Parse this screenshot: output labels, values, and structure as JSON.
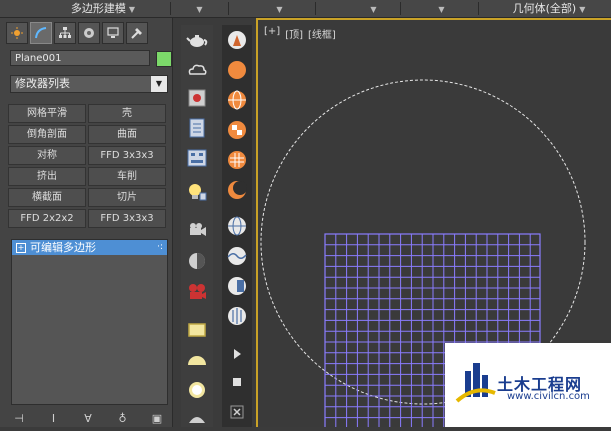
{
  "topbar": {
    "segments": [
      {
        "label": "多边形建模",
        "caret": "▼"
      },
      {
        "label": "",
        "caret": "▼"
      },
      {
        "label": "",
        "caret": "▼"
      },
      {
        "label": "",
        "caret": "▼"
      },
      {
        "label": "",
        "caret": "▼"
      },
      {
        "label": "几何体(全部)",
        "caret": "▼"
      }
    ]
  },
  "panel": {
    "tabs": [
      {
        "icon": "create-icon"
      },
      {
        "icon": "modify-icon"
      },
      {
        "icon": "hierarchy-icon"
      },
      {
        "icon": "motion-icon"
      },
      {
        "icon": "display-icon"
      },
      {
        "icon": "utilities-icon"
      }
    ],
    "object_name": "Plane001",
    "object_color": "#7cd96a",
    "modifier_list": "修改器列表",
    "modifier_buttons": [
      "网格平滑",
      "壳",
      "倒角剖面",
      "曲面",
      "对称",
      "FFD 3x3x3",
      "挤出",
      "车削",
      "横截面",
      "切片",
      "FFD 2x2x2",
      "FFD 3x3x3"
    ],
    "stack_item": "可编辑多边形",
    "stack_item_dots": "·:",
    "stack_tools": [
      "pin-stack-icon",
      "show-end-result-icon",
      "make-unique-icon",
      "remove-modifier-icon",
      "configure-sets-icon"
    ]
  },
  "viewport": {
    "labels": [
      "[+]",
      "[顶]",
      "[线框]"
    ],
    "border_color": "#c9a227",
    "grid_color": "#8a7cff"
  },
  "watermark": {
    "title": "土木工程网",
    "url": "www.civilcn.com"
  }
}
